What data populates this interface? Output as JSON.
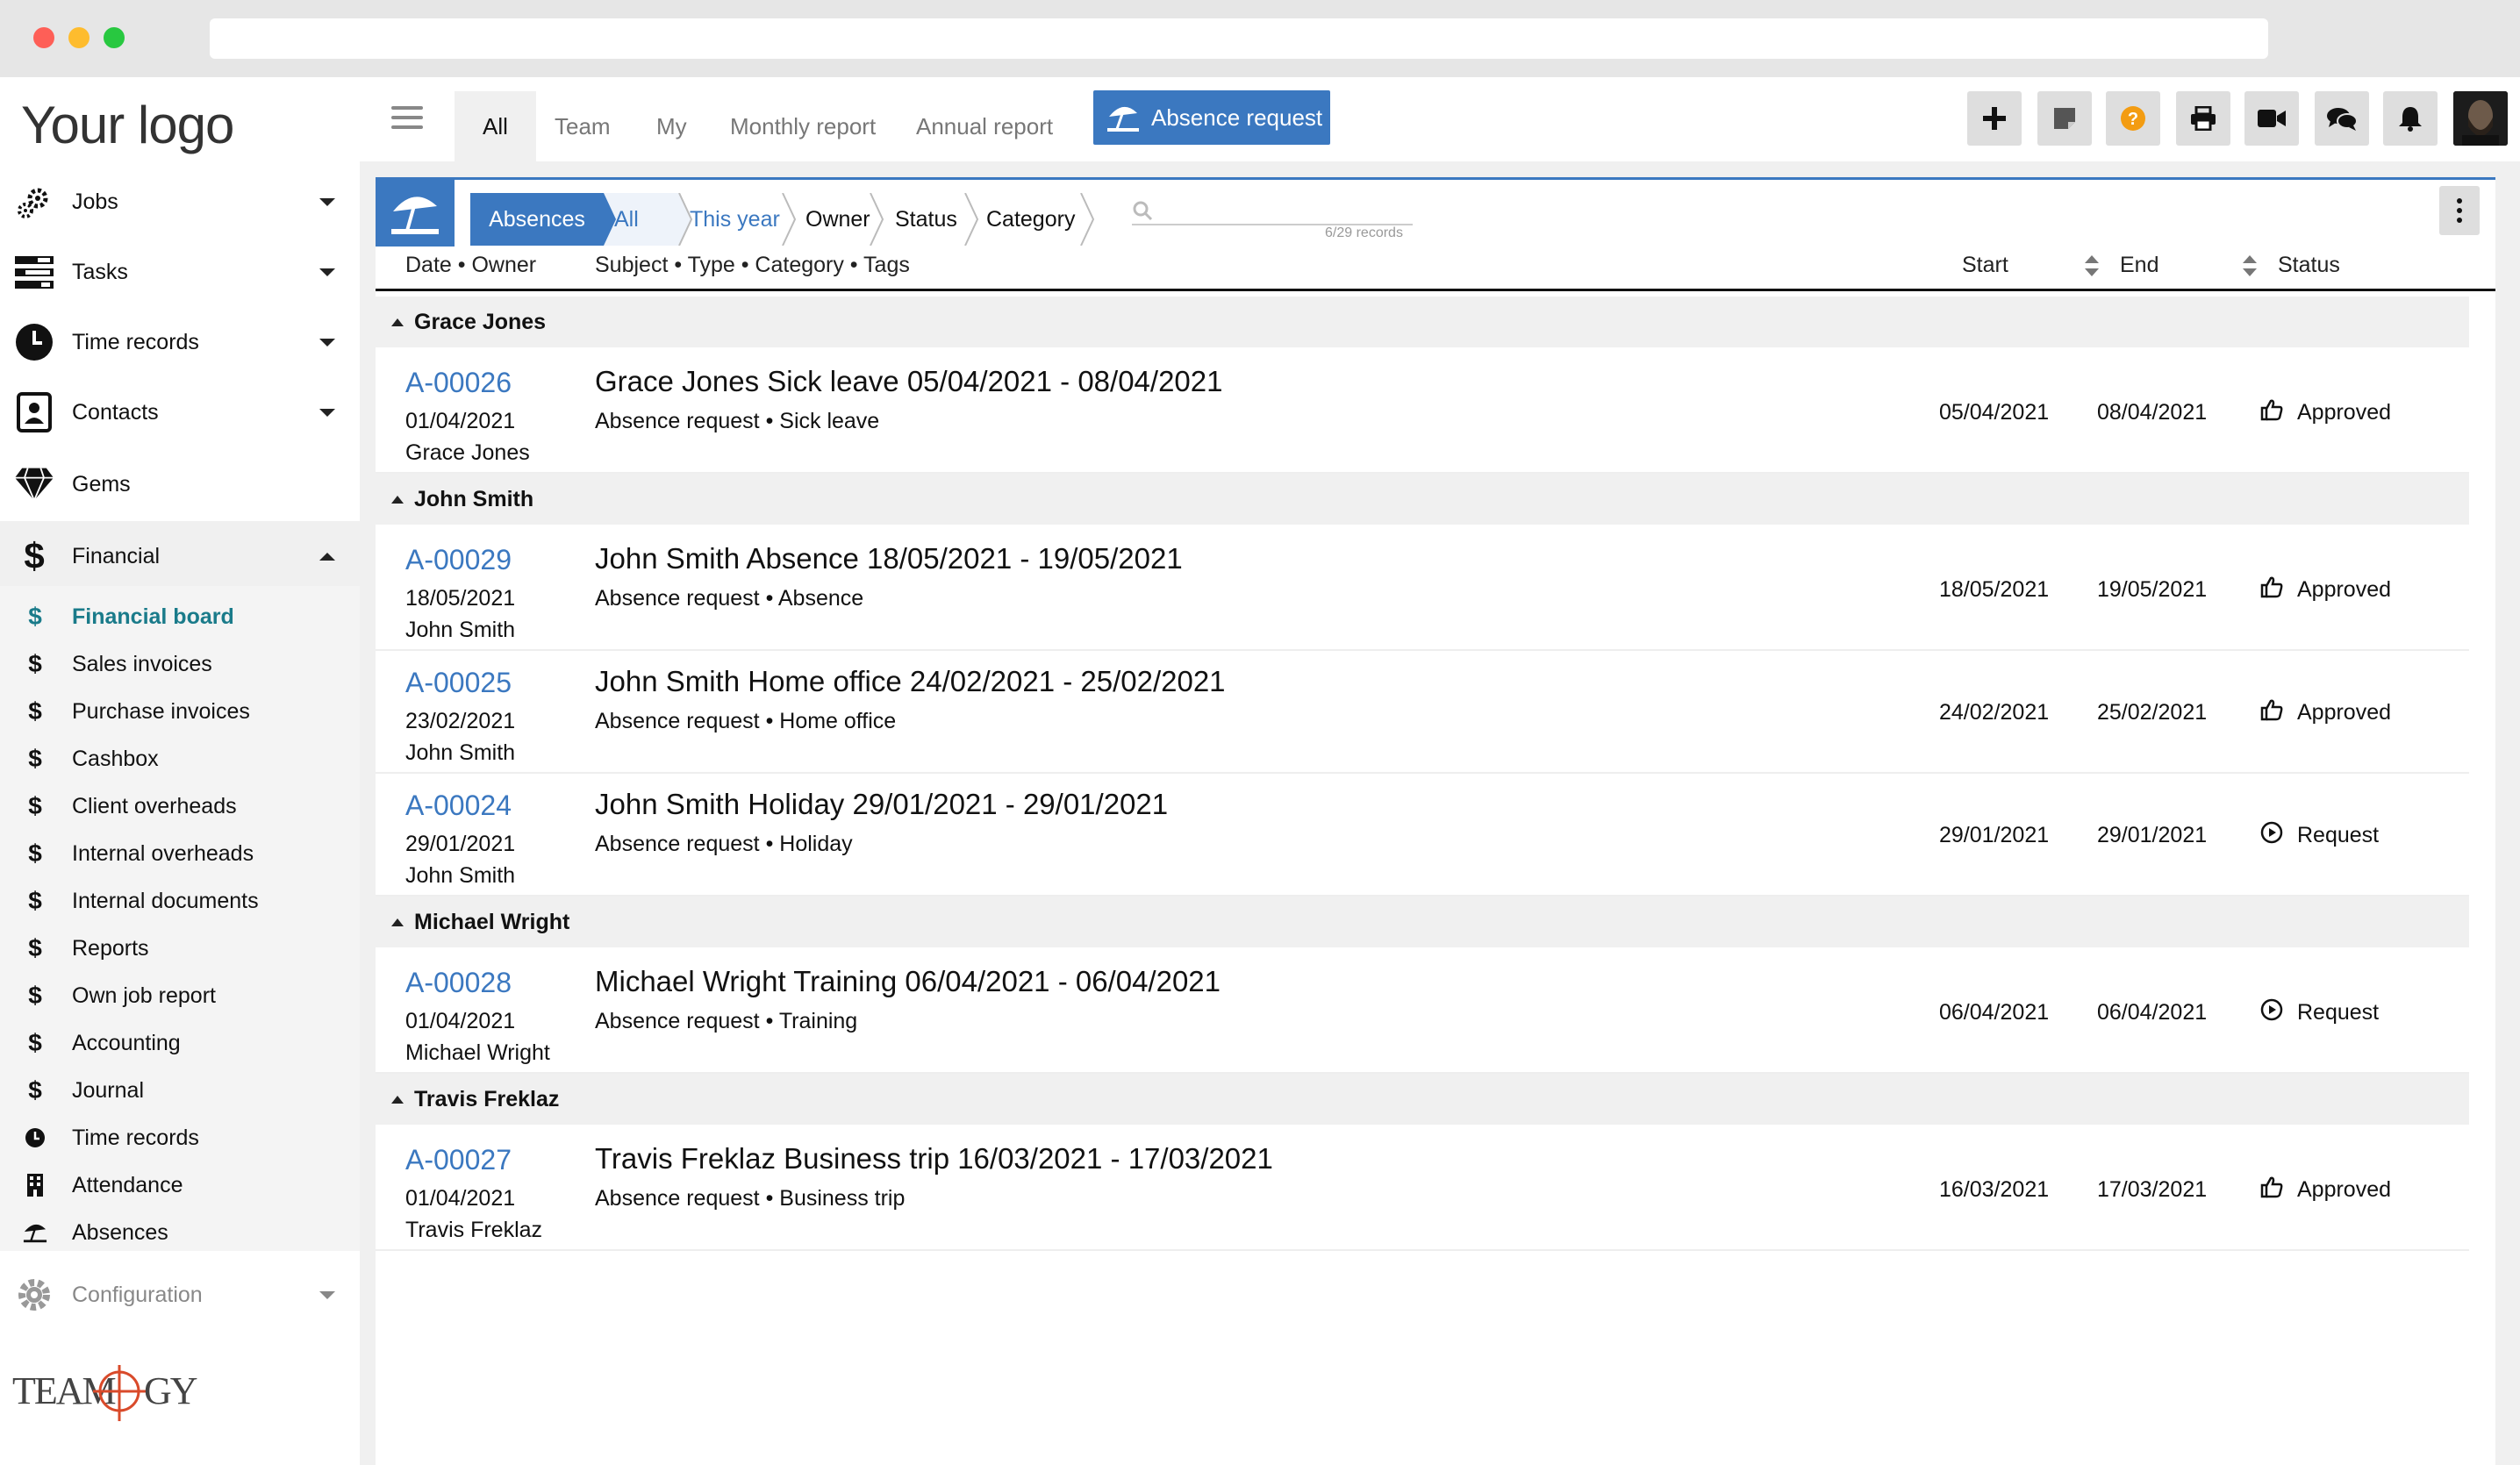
{
  "colors": {
    "accent": "#3b78c0",
    "active_menu": "#1a7b8a",
    "help_orange": "#f39c12"
  },
  "brand": {
    "logo_text": "Your logo",
    "footer_logo_text": "TEAMOGY"
  },
  "sidebar": {
    "items": [
      {
        "label": "Jobs",
        "icon": "gears-icon"
      },
      {
        "label": "Tasks",
        "icon": "tasks-icon"
      },
      {
        "label": "Time records",
        "icon": "clock-icon"
      },
      {
        "label": "Contacts",
        "icon": "contacts-icon"
      },
      {
        "label": "Gems",
        "icon": "diamond-icon"
      },
      {
        "label": "Financial",
        "icon": "dollar-icon"
      }
    ],
    "financial_sub": [
      {
        "label": "Financial board",
        "icon": "dollar-icon"
      },
      {
        "label": "Sales invoices",
        "icon": "dollar-icon"
      },
      {
        "label": "Purchase invoices",
        "icon": "dollar-icon"
      },
      {
        "label": "Cashbox",
        "icon": "dollar-icon"
      },
      {
        "label": "Client overheads",
        "icon": "dollar-icon"
      },
      {
        "label": "Internal overheads",
        "icon": "dollar-icon"
      },
      {
        "label": "Internal documents",
        "icon": "dollar-icon"
      },
      {
        "label": "Reports",
        "icon": "dollar-icon"
      },
      {
        "label": "Own job report",
        "icon": "dollar-icon"
      },
      {
        "label": "Accounting",
        "icon": "dollar-icon"
      },
      {
        "label": "Journal",
        "icon": "dollar-icon"
      },
      {
        "label": "Time records",
        "icon": "clock-icon"
      },
      {
        "label": "Attendance",
        "icon": "building-icon"
      },
      {
        "label": "Absences",
        "icon": "umbrella-icon"
      }
    ],
    "configuration": "Configuration"
  },
  "topbar": {
    "tabs": [
      "All",
      "Team",
      "My",
      "Monthly report",
      "Annual report"
    ],
    "action_button": "Absence request",
    "icons": [
      "plus-icon",
      "note-icon",
      "help-icon",
      "print-icon",
      "video-icon",
      "chat-icon",
      "bell-icon",
      "avatar"
    ]
  },
  "filters": {
    "module": "Absences",
    "crumbs": [
      "All",
      "This year",
      "Owner",
      "Status",
      "Category"
    ],
    "records_count": "6/29 records"
  },
  "columns": {
    "date_owner": "Date • Owner",
    "subject": "Subject • Type • Category • Tags",
    "start": "Start",
    "end": "End",
    "status": "Status"
  },
  "groups": [
    {
      "name": "Grace Jones",
      "rows": [
        {
          "id": "A-00026",
          "date": "01/04/2021",
          "owner": "Grace Jones",
          "subject": "Grace Jones Sick leave 05/04/2021 - 08/04/2021",
          "subline": "Absence request • Sick leave",
          "start": "05/04/2021",
          "end": "08/04/2021",
          "status": "Approved",
          "status_icon": "thumbs-up-icon"
        }
      ]
    },
    {
      "name": "John Smith",
      "rows": [
        {
          "id": "A-00029",
          "date": "18/05/2021",
          "owner": "John Smith",
          "subject": "John Smith Absence 18/05/2021 - 19/05/2021",
          "subline": "Absence request • Absence",
          "start": "18/05/2021",
          "end": "19/05/2021",
          "status": "Approved",
          "status_icon": "thumbs-up-icon"
        },
        {
          "id": "A-00025",
          "date": "23/02/2021",
          "owner": "John Smith",
          "subject": "John Smith Home office 24/02/2021 - 25/02/2021",
          "subline": "Absence request • Home office",
          "start": "24/02/2021",
          "end": "25/02/2021",
          "status": "Approved",
          "status_icon": "thumbs-up-icon"
        },
        {
          "id": "A-00024",
          "date": "29/01/2021",
          "owner": "John Smith",
          "subject": "John Smith Holiday 29/01/2021 - 29/01/2021",
          "subline": "Absence request • Holiday",
          "start": "29/01/2021",
          "end": "29/01/2021",
          "status": "Request",
          "status_icon": "play-circle-icon"
        }
      ]
    },
    {
      "name": "Michael Wright",
      "rows": [
        {
          "id": "A-00028",
          "date": "01/04/2021",
          "owner": "Michael Wright",
          "subject": "Michael Wright Training 06/04/2021 - 06/04/2021",
          "subline": "Absence request • Training",
          "start": "06/04/2021",
          "end": "06/04/2021",
          "status": "Request",
          "status_icon": "play-circle-icon"
        }
      ]
    },
    {
      "name": "Travis Freklaz",
      "rows": [
        {
          "id": "A-00027",
          "date": "01/04/2021",
          "owner": "Travis Freklaz",
          "subject": "Travis Freklaz Business trip 16/03/2021 - 17/03/2021",
          "subline": "Absence request • Business trip",
          "start": "16/03/2021",
          "end": "17/03/2021",
          "status": "Approved",
          "status_icon": "thumbs-up-icon"
        }
      ]
    }
  ]
}
